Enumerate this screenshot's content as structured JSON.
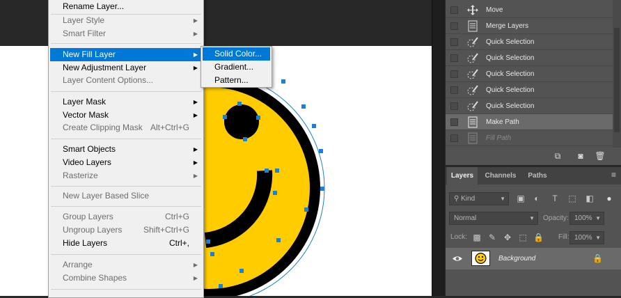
{
  "colors": {
    "accent": "#0078d7",
    "smiley_fill": "#ffcc00",
    "anchor": "#1e7fd8"
  },
  "menu": {
    "items": [
      {
        "label": "Rename Layer...",
        "shortcut": "",
        "submenu": false,
        "enabled": true
      },
      {
        "label": "Layer Style",
        "shortcut": "",
        "submenu": true,
        "enabled": false
      },
      {
        "label": "Smart Filter",
        "shortcut": "",
        "submenu": true,
        "enabled": false
      },
      {
        "label": "New Fill Layer",
        "shortcut": "",
        "submenu": true,
        "enabled": true,
        "highlighted": true
      },
      {
        "label": "New Adjustment Layer",
        "shortcut": "",
        "submenu": true,
        "enabled": true
      },
      {
        "label": "Layer Content Options...",
        "shortcut": "",
        "submenu": false,
        "enabled": false
      },
      {
        "label": "Layer Mask",
        "shortcut": "",
        "submenu": true,
        "enabled": true
      },
      {
        "label": "Vector Mask",
        "shortcut": "",
        "submenu": true,
        "enabled": true
      },
      {
        "label": "Create Clipping Mask",
        "shortcut": "Alt+Ctrl+G",
        "submenu": false,
        "enabled": false
      },
      {
        "label": "Smart Objects",
        "shortcut": "",
        "submenu": true,
        "enabled": true
      },
      {
        "label": "Video Layers",
        "shortcut": "",
        "submenu": true,
        "enabled": true
      },
      {
        "label": "Rasterize",
        "shortcut": "",
        "submenu": true,
        "enabled": false
      },
      {
        "label": "New Layer Based Slice",
        "shortcut": "",
        "submenu": false,
        "enabled": false
      },
      {
        "label": "Group Layers",
        "shortcut": "Ctrl+G",
        "submenu": false,
        "enabled": false
      },
      {
        "label": "Ungroup Layers",
        "shortcut": "Shift+Ctrl+G",
        "submenu": false,
        "enabled": false
      },
      {
        "label": "Hide Layers",
        "shortcut": "Ctrl+,",
        "submenu": false,
        "enabled": true
      },
      {
        "label": "Arrange",
        "shortcut": "",
        "submenu": true,
        "enabled": false
      },
      {
        "label": "Combine Shapes",
        "shortcut": "",
        "submenu": true,
        "enabled": false
      }
    ],
    "submenu": [
      {
        "label": "Solid Color...",
        "highlighted": true
      },
      {
        "label": "Gradient..."
      },
      {
        "label": "Pattern..."
      }
    ]
  },
  "history": {
    "steps": [
      {
        "label": "Move",
        "icon": "move-icon"
      },
      {
        "label": "Merge Layers",
        "icon": "document-icon"
      },
      {
        "label": "Quick Selection",
        "icon": "quick-selection-icon"
      },
      {
        "label": "Quick Selection",
        "icon": "quick-selection-icon"
      },
      {
        "label": "Quick Selection",
        "icon": "quick-selection-icon"
      },
      {
        "label": "Quick Selection",
        "icon": "quick-selection-icon"
      },
      {
        "label": "Quick Selection",
        "icon": "quick-selection-icon"
      },
      {
        "label": "Make Path",
        "icon": "document-icon",
        "selected": true
      },
      {
        "label": "Fill Path",
        "icon": "document-icon",
        "undone": true
      }
    ]
  },
  "layers": {
    "tabs": [
      "Layers",
      "Channels",
      "Paths"
    ],
    "active_tab": "Layers",
    "filter_kind": "Kind",
    "blend_mode": "Normal",
    "opacity_label": "Opacity:",
    "opacity_value": "100%",
    "lock_label": "Lock:",
    "fill_label": "Fill:",
    "fill_value": "100%",
    "layer_name": "Background",
    "layer_visible": true,
    "layer_locked": true
  }
}
